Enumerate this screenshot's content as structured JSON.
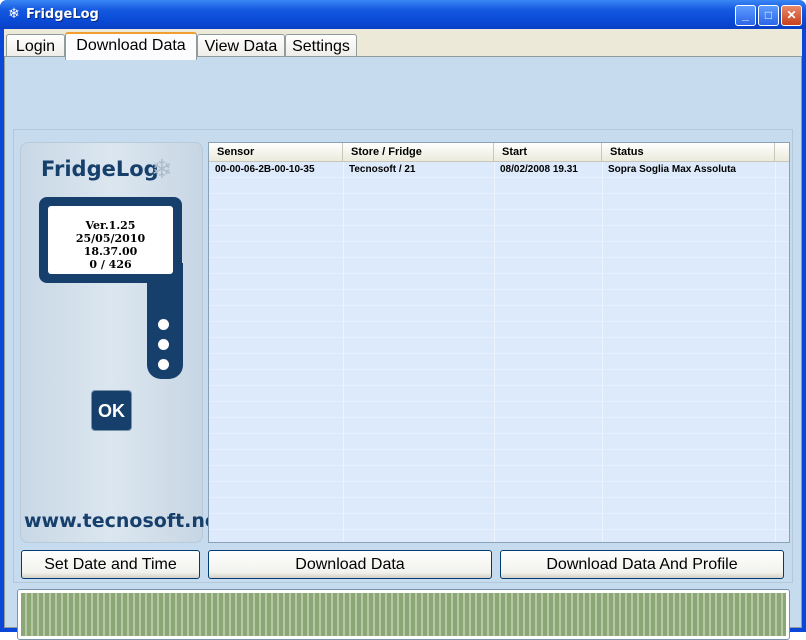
{
  "window": {
    "title": "FridgeLog",
    "icon": "snowflake-icon"
  },
  "tabs": [
    {
      "label": "Login"
    },
    {
      "label": "Download Data"
    },
    {
      "label": "View Data"
    },
    {
      "label": "Settings"
    }
  ],
  "active_tab": "Download Data",
  "device": {
    "brand": "FridgeLog",
    "version": "Ver.1.25",
    "datetime": "25/05/2010 18.37.00",
    "count": "0 / 426",
    "ok_label": "OK",
    "website": "www.tecnosoft.net"
  },
  "table": {
    "columns": [
      "Sensor",
      "Store / Fridge",
      "Start",
      "Status"
    ],
    "rows": [
      {
        "sensor": "00-00-06-2B-00-10-35",
        "store": "Tecnosoft / 21",
        "start": "08/02/2008 19.31",
        "status": "Sopra Soglia Max Assoluta"
      }
    ]
  },
  "buttons": {
    "set_date": "Set Date and Time",
    "download": "Download Data",
    "download_profile": "Download Data And Profile"
  },
  "progress": {
    "value": 1.0
  },
  "colors": {
    "titlebar": "#0a4bd6",
    "panel": "#c6dbee",
    "brand": "#163f6c",
    "progress": "#8ca676"
  }
}
